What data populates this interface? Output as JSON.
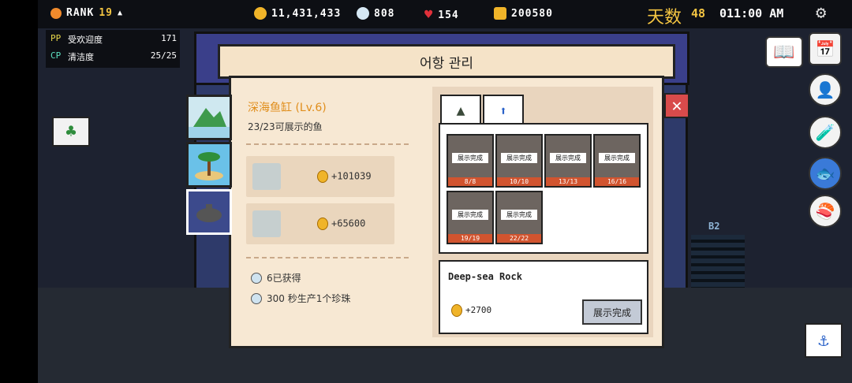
{
  "hud": {
    "rank_label": "RANK",
    "rank_value": "19",
    "gold": "11,431,433",
    "pearls": "808",
    "hearts": "154",
    "medals": "200580",
    "days_label": "天数",
    "day_number": "48",
    "time": "011:00 AM"
  },
  "stats": [
    {
      "key": "PP",
      "label": "受欢迎度",
      "value": "171"
    },
    {
      "key": "CP",
      "label": "清洁度",
      "value": "25/25"
    }
  ],
  "floor_label": "B2",
  "modal": {
    "title": "어항 관리",
    "tank_title": "深海鱼缸 (Lv.6)",
    "tank_sub": "23/23可展示的鱼",
    "rewards": [
      {
        "icon": "sushi-icon",
        "value": "+101039"
      },
      {
        "icon": "rock-icon",
        "value": "+65600"
      }
    ],
    "info": [
      "6已获得",
      "300 秒生产1个珍珠"
    ],
    "grid_items": [
      {
        "label": "展示完成",
        "count": "8/8"
      },
      {
        "label": "展示完成",
        "count": "10/10"
      },
      {
        "label": "展示完成",
        "count": "13/13"
      },
      {
        "label": "展示完成",
        "count": "16/16"
      },
      {
        "label": "展示完成",
        "count": "19/19"
      },
      {
        "label": "展示完成",
        "count": "22/22"
      }
    ],
    "detail": {
      "name": "Deep-sea Rock",
      "reward": "+2700",
      "button": "展示完成"
    }
  },
  "colors": {
    "accent_orange": "#e08d1a",
    "count_red": "#d1542f",
    "gold": "#f4c542"
  }
}
